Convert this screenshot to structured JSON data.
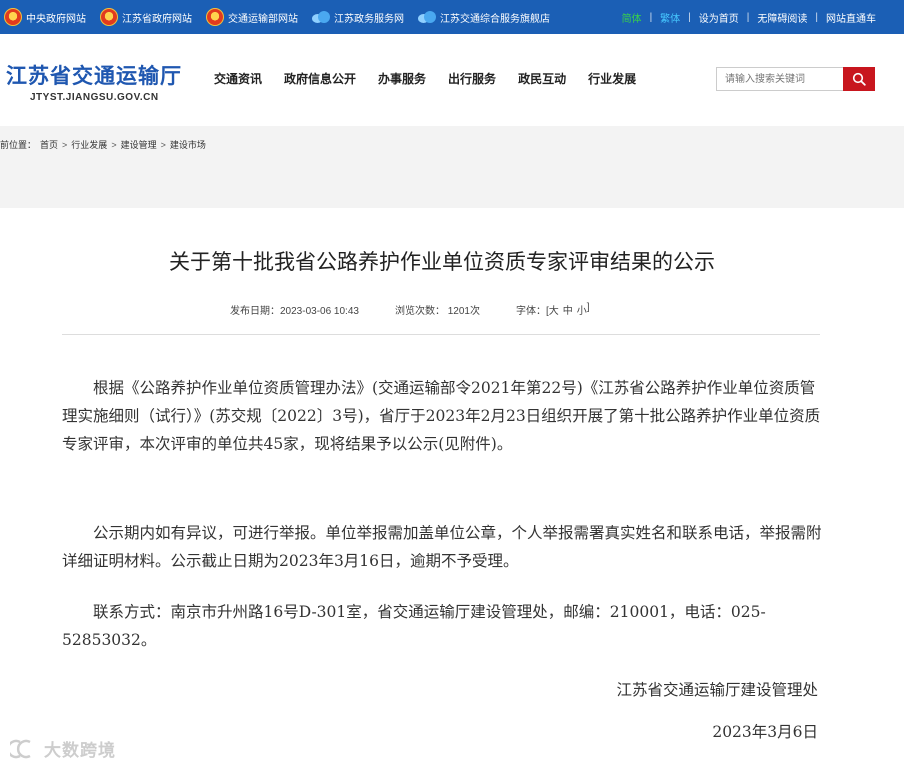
{
  "topbar": {
    "links": [
      {
        "label": "中央政府网站",
        "icon": "national-emblem-icon"
      },
      {
        "label": "江苏省政府网站",
        "icon": "national-emblem-icon"
      },
      {
        "label": "交通运输部网站",
        "icon": "national-emblem-icon"
      },
      {
        "label": "江苏政务服务网",
        "icon": "cloud-logo-icon"
      },
      {
        "label": "江苏交通综合服务旗舰店",
        "icon": "cloud-logo-icon"
      }
    ],
    "right": {
      "simplified": "简体",
      "traditional": "繁体",
      "homepage": "设为首页",
      "accessibility": "无障碍阅读",
      "directory": "网站直通车"
    }
  },
  "header": {
    "logo_cn": "江苏省交通运输厅",
    "logo_en": "JTYST.JIANGSU.GOV.CN",
    "nav": [
      "交通资讯",
      "政府信息公开",
      "办事服务",
      "出行服务",
      "政民互动",
      "行业发展"
    ],
    "search_placeholder": "请输入搜索关键词"
  },
  "breadcrumb": {
    "prefix": "前位置：",
    "items": [
      "首页",
      "行业发展",
      "建设管理",
      "建设市场"
    ]
  },
  "article": {
    "title": "关于第十批我省公路养护作业单位资质专家评审结果的公示",
    "publish_date": "发布日期：2023-03-06 10:43",
    "views": "浏览次数：  1201次",
    "font_label": "字体：[",
    "font_large": "大",
    "font_medium": "中",
    "font_small": "小",
    "font_close": "]",
    "paragraph_1": "根据《公路养护作业单位资质管理办法》(交通运输部令2021年第22号)《江苏省公路养护作业单位资质管理实施细则（试行）》(苏交规〔2022〕3号)，省厅于2023年2月23日组织开展了第十批公路养护作业单位资质专家评审，本次评审的单位共45家，现将结果予以公示(见附件)。",
    "paragraph_2": "公示期内如有异议，可进行举报。单位举报需加盖单位公章，个人举报需署真实姓名和联系电话，举报需附详细证明材料。公示截止日期为2023年3月16日，逾期不予受理。",
    "paragraph_3": "联系方式：南京市升州路16号D-301室，省交通运输厅建设管理处，邮编：210001，电话：025-52853032。",
    "signature": "江苏省交通运输厅建设管理处",
    "date": "2023年3月6日"
  },
  "watermark": {
    "text": "大数跨境"
  },
  "colors": {
    "topbar": "#1b5fb5",
    "logo": "#1f57b0",
    "search_button": "#c8161e",
    "breadcrumb_bg": "#f3f3f3"
  }
}
